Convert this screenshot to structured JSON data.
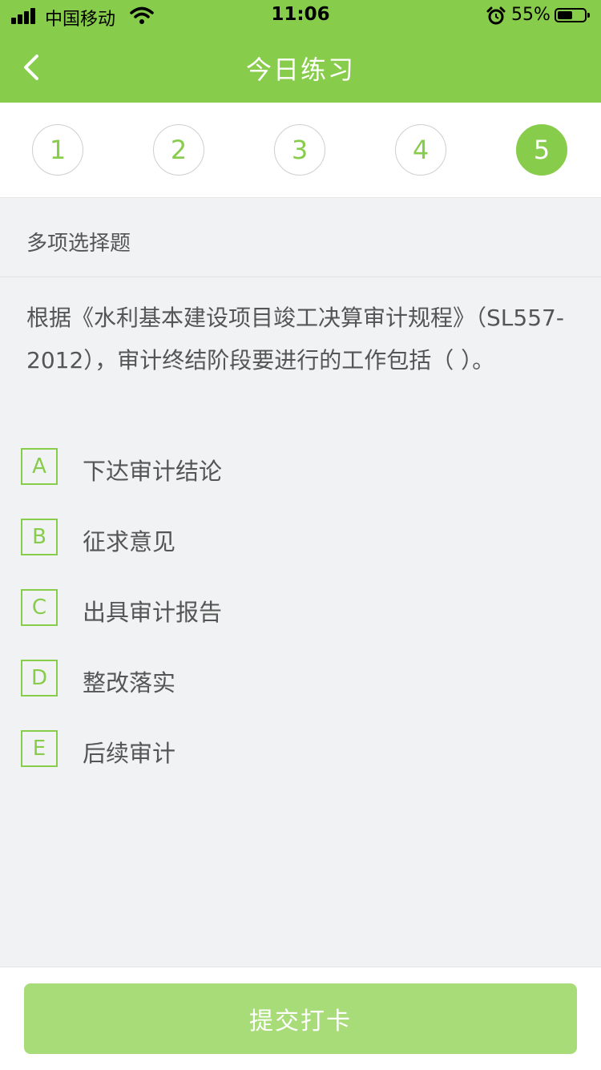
{
  "status_bar": {
    "carrier": "中国移动",
    "time": "11:06",
    "battery": "55%",
    "battery_level": 0.55
  },
  "header": {
    "title": "今日练习",
    "back_icon": "chevron-left-icon"
  },
  "question_nav": {
    "items": [
      "1",
      "2",
      "3",
      "4",
      "5"
    ],
    "active_index": 4
  },
  "question": {
    "type": "多项选择题",
    "text": "根据《水利基本建设项目竣工决算审计规程》（SL557-2012），审计终结阶段要进行的工作包括（ ）。",
    "options": [
      {
        "key": "A",
        "text": "下达审计结论"
      },
      {
        "key": "B",
        "text": "征求意见"
      },
      {
        "key": "C",
        "text": "出具审计报告"
      },
      {
        "key": "D",
        "text": "整改落实"
      },
      {
        "key": "E",
        "text": "后续审计"
      }
    ]
  },
  "footer": {
    "submit_label": "提交打卡"
  },
  "colors": {
    "accent": "#87cc4a",
    "button_disabled": "#a8dc78",
    "background": "#f1f2f4"
  }
}
